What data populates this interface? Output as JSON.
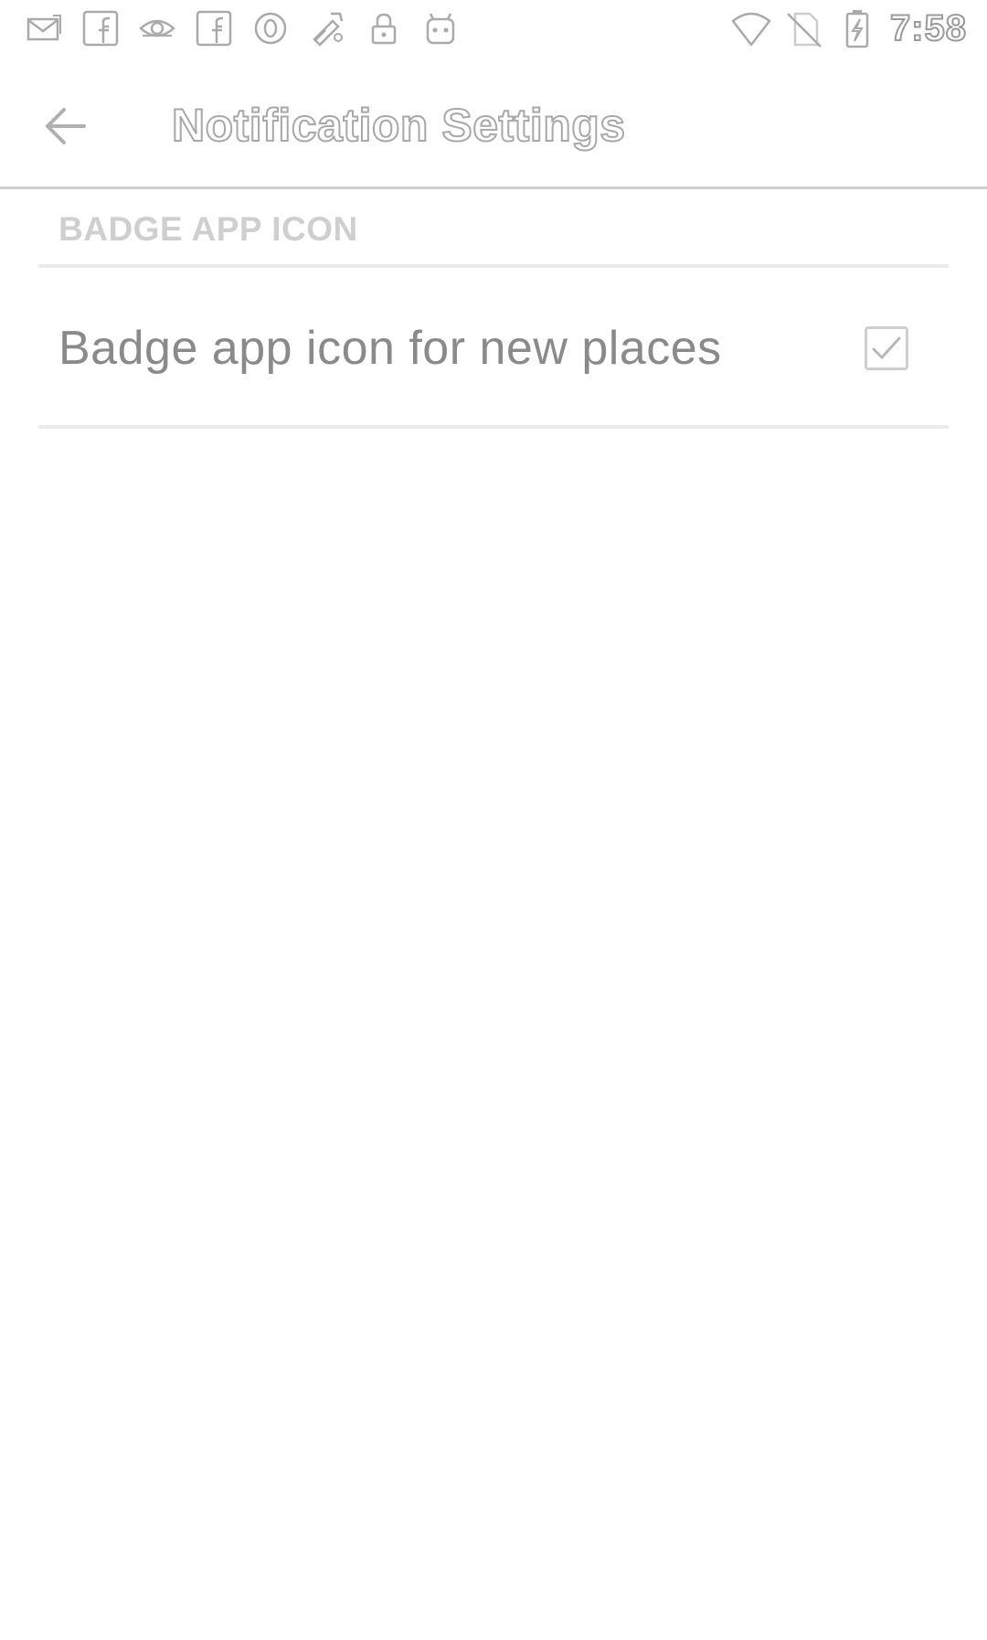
{
  "status_bar": {
    "time": "7:58",
    "notification_icons": [
      "mail-icon",
      "facebook-icon",
      "eye-app-icon",
      "facebook-icon",
      "circle-app-icon",
      "fake-gps-icon",
      "lock-icon",
      "android-icon"
    ],
    "system_icons": [
      "wifi-icon",
      "no-sim-icon",
      "battery-charging-icon"
    ]
  },
  "app_bar": {
    "back_icon": "arrow-back-icon",
    "title": "Notification Settings"
  },
  "section": {
    "header": "BADGE APP ICON",
    "preference": {
      "label": "Badge app icon for new places",
      "checked": true
    }
  },
  "colors": {
    "background": "#ffffff",
    "outline_text": "#a8a8a8",
    "section_header": "#cfcfcf",
    "body_text": "#8a8a8a",
    "divider": "#ebebeb"
  }
}
